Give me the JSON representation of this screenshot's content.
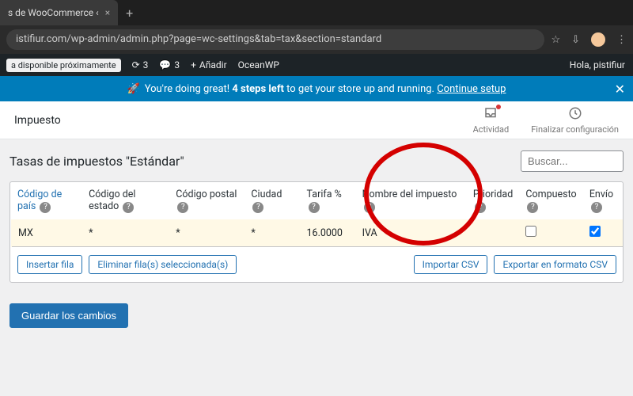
{
  "browser": {
    "tab_title": "s de WooCommerce ‹",
    "url": "istifiur.com/wp-admin/admin.php?page=wc-settings&tab=tax&section=standard"
  },
  "admin_bar": {
    "coming_soon": "a disponible próximamente",
    "comments_count": "3",
    "updates_count": "3",
    "add_label": "Añadir",
    "theme_label": "OceanWP",
    "greeting": "Hola, pistifiur"
  },
  "banner": {
    "rocket": "🚀",
    "text_lead": "You're doing great!",
    "text_bold": "4 steps left",
    "text_tail": "to get your store up and running.",
    "link": "Continue setup"
  },
  "page_header": {
    "title": "Impuesto",
    "activity": "Actividad",
    "finalize": "Finalizar configuración"
  },
  "main": {
    "heading": "Tasas de impuestos \"Estándar\"",
    "search_placeholder": "Buscar..."
  },
  "columns": {
    "country": "Código de país",
    "state": "Código del estado",
    "postal": "Código postal",
    "city": "Ciudad",
    "rate": "Tarifa %",
    "name": "Nombre del impuesto",
    "priority": "Prioridad",
    "compound": "Compuesto",
    "shipping": "Envío"
  },
  "row": {
    "country": "MX",
    "state": "*",
    "postal": "*",
    "city": "*",
    "rate": "16.0000",
    "name": "IVA",
    "priority": ""
  },
  "footer": {
    "insert": "Insertar fila",
    "remove": "Eliminar fila(s) seleccionada(s)",
    "import": "Importar CSV",
    "export": "Exportar en formato CSV"
  },
  "save_btn": "Guardar los cambios"
}
